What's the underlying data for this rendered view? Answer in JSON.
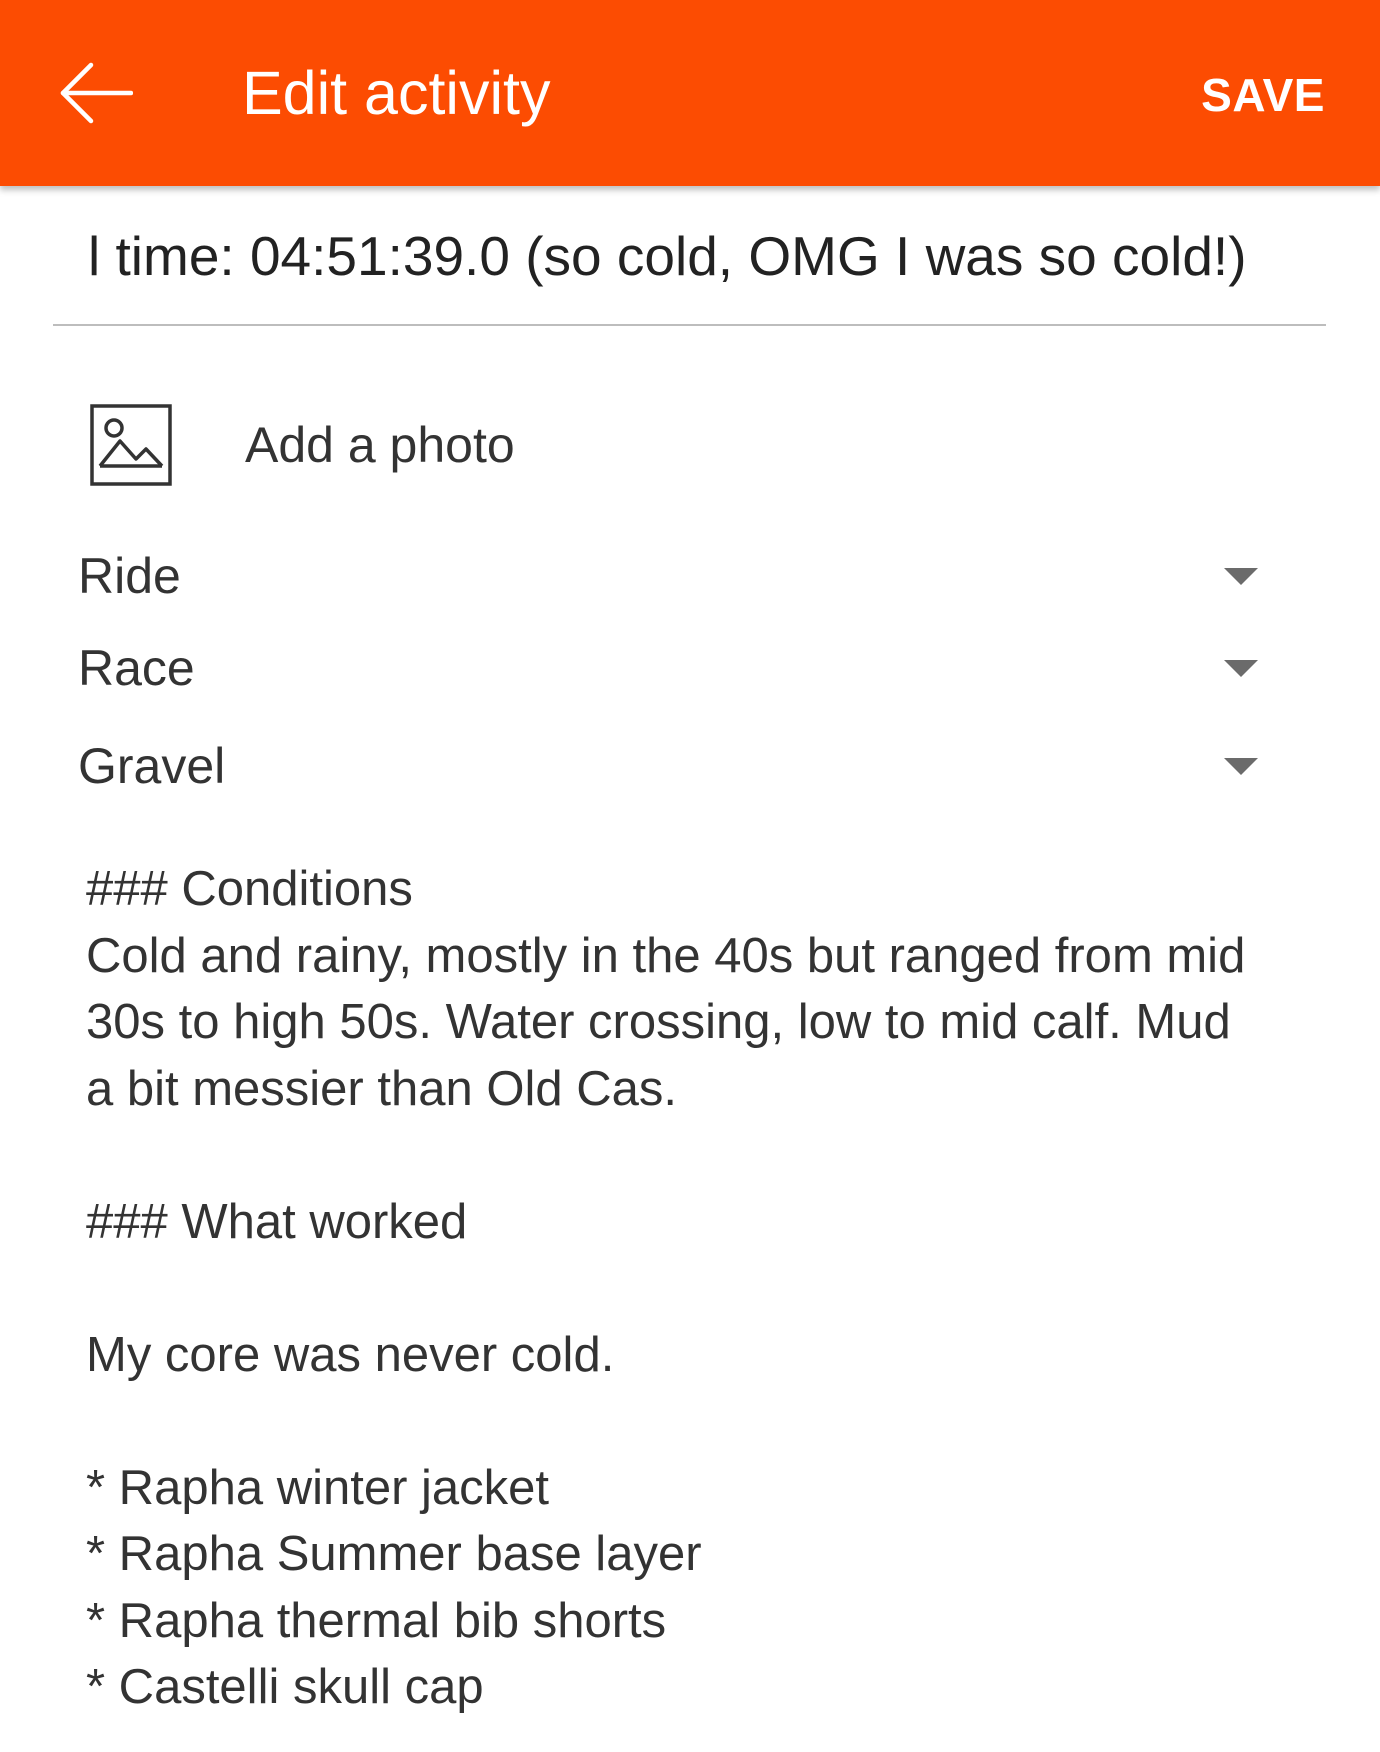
{
  "header": {
    "title": "Edit activity",
    "save_label": "SAVE",
    "back_icon": "arrow-left-icon",
    "background": "#fc4c02"
  },
  "title_field": {
    "value": "l time: 04:51:39.0 (so cold, OMG I was so cold!)"
  },
  "photo": {
    "icon": "image-icon",
    "label": "Add a photo"
  },
  "selects": {
    "sport": "Ride",
    "type": "Race",
    "bike": "Gravel"
  },
  "description": {
    "lines": [
      "### Conditions",
      "Cold and rainy, mostly in the 40s but ranged from mid",
      "30s to high 50s. Water crossing, low to mid calf. Mud",
      "a bit messier than Old Cas.",
      "",
      "### What worked",
      "",
      "My core was never cold.",
      "",
      "* Rapha winter jacket",
      "* Rapha Summer base layer",
      "* Rapha thermal bib shorts",
      "* Castelli skull cap"
    ]
  }
}
